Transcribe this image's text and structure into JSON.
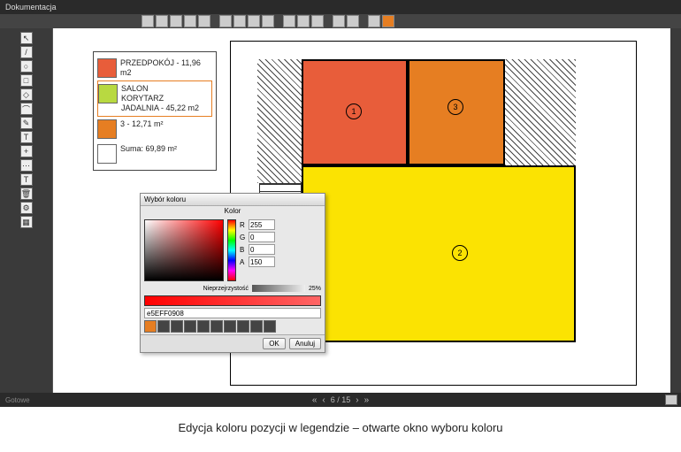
{
  "window": {
    "title": "Dokumentacja"
  },
  "toolbar": {
    "icons": 20
  },
  "left_tools": [
    "↖",
    "/",
    "○",
    "□",
    "◇",
    "⌒",
    "✎",
    "T",
    "+",
    "⋯",
    "T",
    "🗑",
    "⚙",
    "▦"
  ],
  "legend": {
    "items": [
      {
        "color": "#e85d3a",
        "label": "PRZEDPOKÓJ - 11,96 m2",
        "selected": false
      },
      {
        "color": "#b8d941",
        "label": "SALON\nKORYTARZ\nJADALNIA - 45,22 m2",
        "selected": true
      },
      {
        "color": "#e67e22",
        "label": "3 - 12,71 m²",
        "selected": false
      },
      {
        "color": "#ffffff",
        "label": "Suma: 69,89 m²",
        "selected": false
      }
    ]
  },
  "rooms": [
    {
      "id": "1",
      "color": "#e85d3a"
    },
    {
      "id": "2",
      "color": "#fbe302"
    },
    {
      "id": "3",
      "color": "#e67e22"
    }
  ],
  "color_dialog": {
    "title": "Wybór koloru",
    "subtitle": "Kolor",
    "r": "255",
    "g": "0",
    "b": "0",
    "a": "150",
    "trans_label": "Nieprzejrzystość",
    "trans_value": "25%",
    "hex": "e5EFF0908",
    "palette": [
      "#e67e22",
      "#444",
      "#444",
      "#444",
      "#444",
      "#444",
      "#444",
      "#444",
      "#444",
      "#444"
    ],
    "ok": "OK",
    "cancel": "Anuluj"
  },
  "pager": {
    "prev": "‹",
    "next": "›",
    "page": "6 / 15",
    "dprev": "«",
    "dnext": "»"
  },
  "status": "Gotowe",
  "caption": "Edycja koloru pozycji w legendzie – otwarte okno wyboru koloru"
}
